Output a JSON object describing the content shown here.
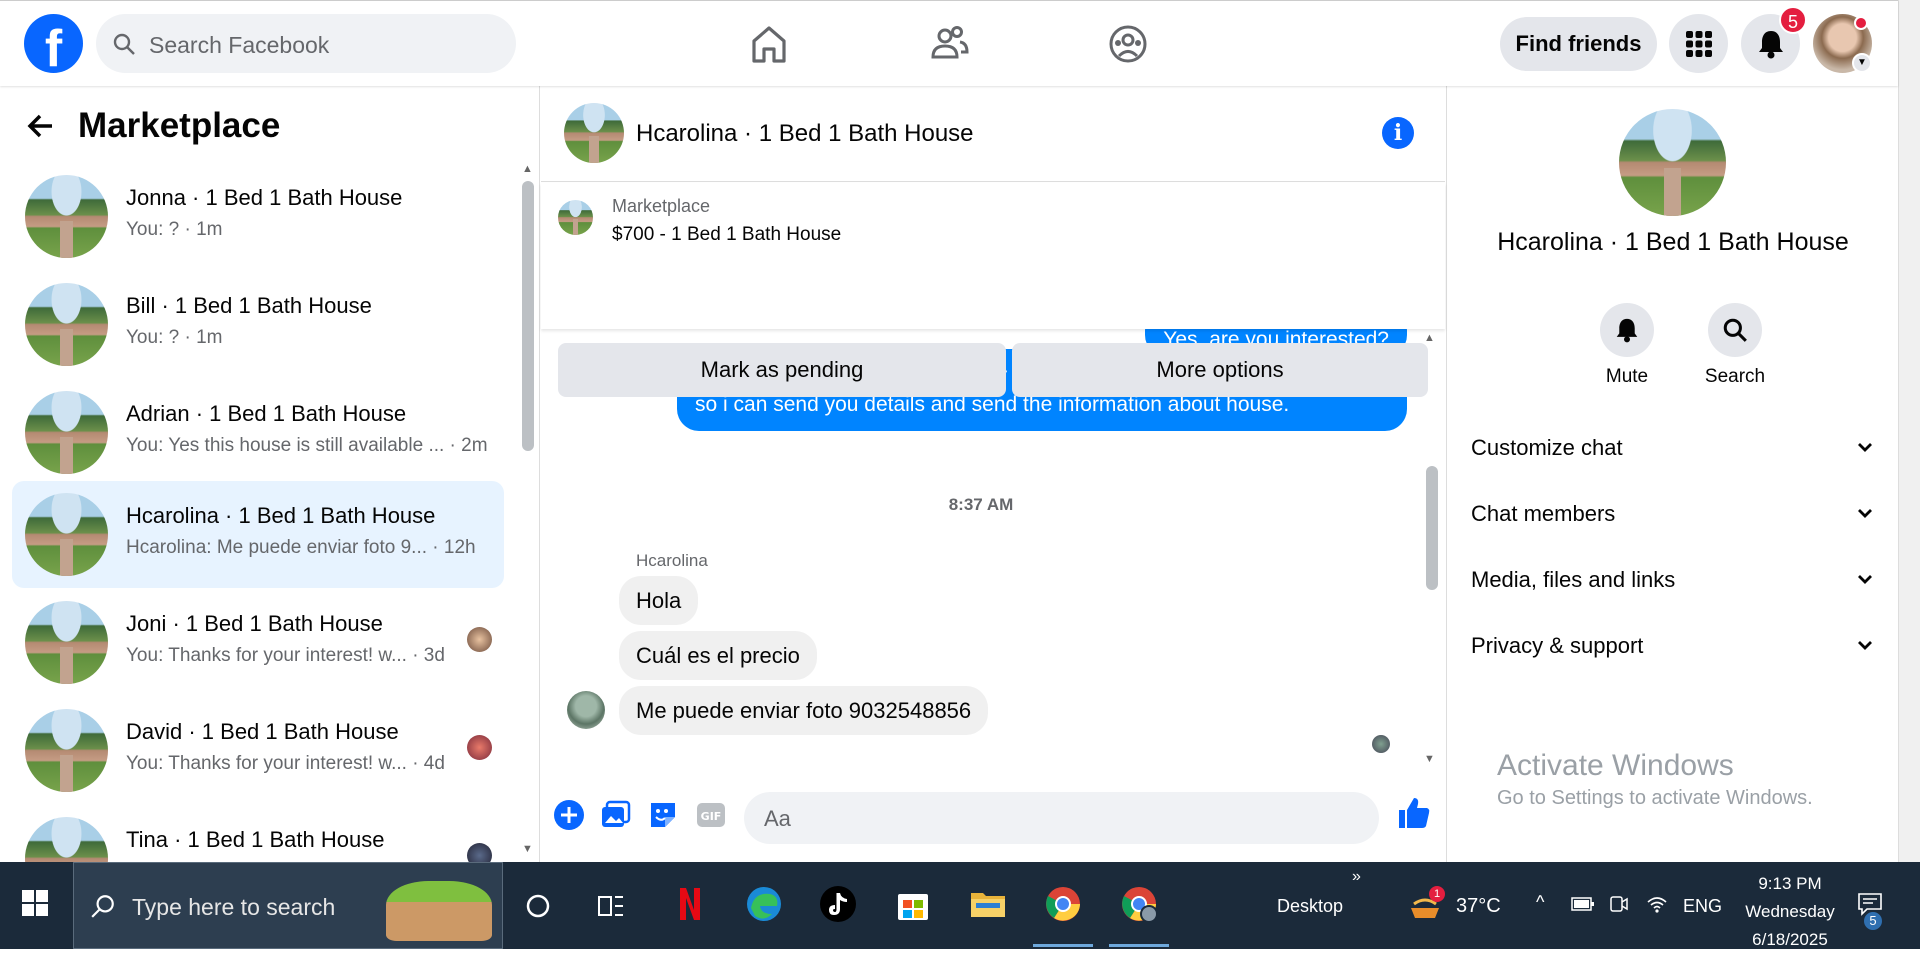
{
  "topbar": {
    "logo": "f",
    "search_placeholder": "Search Facebook",
    "find_friends": "Find friends",
    "notification_count": "5"
  },
  "sidebar": {
    "title": "Marketplace",
    "conversations": [
      {
        "name": "Jonna · 1 Bed 1 Bath House",
        "preview": "You: ? · 1m"
      },
      {
        "name": "Bill · 1 Bed 1 Bath House",
        "preview": "You: ? · 1m"
      },
      {
        "name": "Adrian · 1 Bed 1 Bath House",
        "preview": "You: Yes this house is still available ... · 2m"
      },
      {
        "name": "Hcarolina · 1 Bed 1 Bath House",
        "preview": "Hcarolina: Me puede enviar foto 9... · 12h"
      },
      {
        "name": "Joni · 1 Bed 1 Bath House",
        "preview": "You: Thanks for your interest! w... · 3d"
      },
      {
        "name": "David · 1 Bed 1 Bath House",
        "preview": "You: Thanks for your interest! w... · 4d"
      },
      {
        "name": "Tina · 1 Bed 1 Bath House",
        "preview": ""
      }
    ]
  },
  "chat": {
    "title": "Hcarolina · 1 Bed 1 Bath House",
    "listing_label": "Marketplace",
    "listing_price": "$700 - 1 Bed 1 Bath House",
    "mark_pending": "Mark as pending",
    "more_options": "More options",
    "partial_message": "Yes, are you interested?",
    "outgoing_message": "Yes this house is still available for rent, let me have your contact number so i can send you details and send the information about house.",
    "timestamp": "8:37 AM",
    "sender": "Hcarolina",
    "incoming": [
      "Hola",
      "Cuál es el precio",
      "Me puede enviar foto 9032548856"
    ],
    "composer_placeholder": "Aa"
  },
  "rightpanel": {
    "name": "Hcarolina · 1 Bed 1 Bath House",
    "mute": "Mute",
    "search": "Search",
    "sections": [
      "Customize chat",
      "Chat members",
      "Media, files and links",
      "Privacy & support"
    ],
    "watermark_title": "Activate Windows",
    "watermark_sub": "Go to Settings to activate Windows."
  },
  "taskbar": {
    "search_placeholder": "Type here to search",
    "desktop_label": "Desktop",
    "temperature": "37°C",
    "language": "ENG",
    "time": "9:13 PM",
    "day": "Wednesday",
    "date": "6/18/2025",
    "notification_count": "5",
    "weather_badge": "1"
  },
  "colors": {
    "facebook_blue": "#0866ff",
    "messenger_blue": "#0084ff",
    "active_row": "#e7f3ff",
    "badge_red": "#e41e3f",
    "taskbar": "#1b2a3a"
  }
}
